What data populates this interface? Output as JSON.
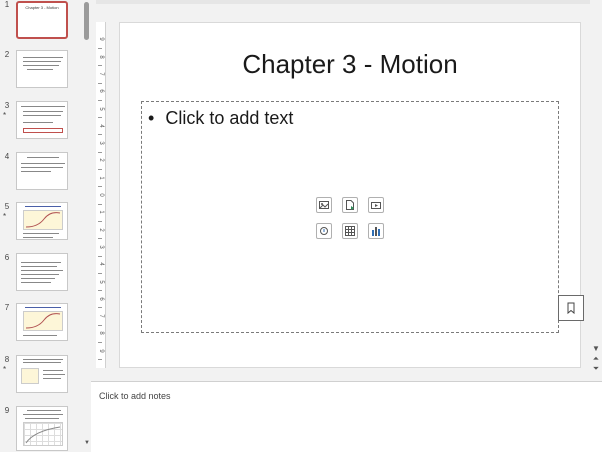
{
  "slides_panel": {
    "slides": [
      {
        "number": "1",
        "title": "Chapter 3 - Motion",
        "active": true,
        "star": ""
      },
      {
        "number": "2",
        "title": "",
        "active": false,
        "star": ""
      },
      {
        "number": "3",
        "title": "",
        "active": false,
        "star": "*"
      },
      {
        "number": "4",
        "title": "",
        "active": false,
        "star": ""
      },
      {
        "number": "5",
        "title": "",
        "active": false,
        "star": "*"
      },
      {
        "number": "6",
        "title": "",
        "active": false,
        "star": ""
      },
      {
        "number": "7",
        "title": "",
        "active": false,
        "star": ""
      },
      {
        "number": "8",
        "title": "",
        "active": false,
        "star": "*"
      },
      {
        "number": "9",
        "title": "",
        "active": false,
        "star": ""
      }
    ]
  },
  "ruler": {
    "ticks": [
      "9",
      "8",
      "7",
      "6",
      "5",
      "4",
      "3",
      "2",
      "1",
      "0",
      "1",
      "2",
      "3",
      "4",
      "5",
      "6",
      "7",
      "8",
      "9"
    ]
  },
  "slide": {
    "title": "Chapter 3 - Motion",
    "placeholder_bullet": "•",
    "placeholder_text": "Click to add text",
    "insert_icons": [
      "image-icon",
      "document-icon",
      "video-icon",
      "audio-icon",
      "table-icon",
      "chart-icon"
    ]
  },
  "notes": {
    "placeholder": "Click to add notes"
  }
}
